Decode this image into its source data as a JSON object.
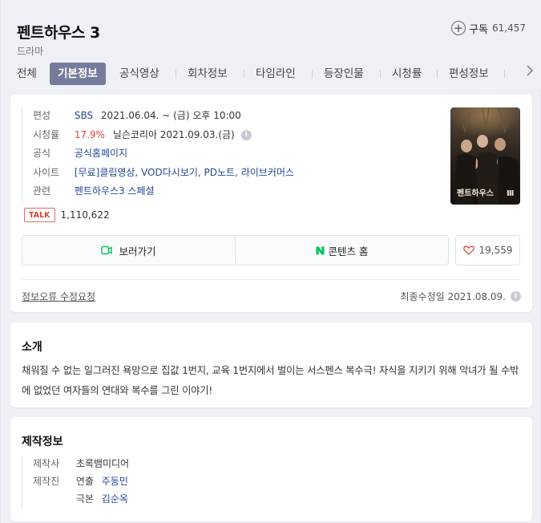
{
  "header": {
    "title": "펜트하우스 3",
    "genre": "드라마",
    "subscribe_label": "구독",
    "subscribe_count": "61,457"
  },
  "tabs": [
    {
      "label": "전체",
      "active": false
    },
    {
      "label": "기본정보",
      "active": true
    },
    {
      "label": "공식영상",
      "active": false
    },
    {
      "label": "회차정보",
      "active": false
    },
    {
      "label": "타임라인",
      "active": false
    },
    {
      "label": "등장인물",
      "active": false
    },
    {
      "label": "시청률",
      "active": false
    },
    {
      "label": "편성정보",
      "active": false
    }
  ],
  "info": {
    "broadcast": {
      "label": "편성",
      "channel": "SBS",
      "schedule": "2021.06.04. ~ (금) 오후 10:00"
    },
    "rating": {
      "label": "시청률",
      "value": "17.9%",
      "source": "닐슨코리아 2021.09.03.(금)"
    },
    "official": {
      "label": "공식",
      "link": "공식홈페이지"
    },
    "site": {
      "label": "사이트",
      "links": "[무료]클립영상, VOD다시보기, PD노트, 라이브커머스"
    },
    "related": {
      "label": "관련",
      "link": "펜트하우스3 스페셜"
    },
    "talk": {
      "badge": "TALK",
      "count": "1,110,622"
    }
  },
  "actions": {
    "watch_label": "보러가기",
    "content_home_label": "콘텐츠 홈",
    "like_count": "19,559"
  },
  "footer": {
    "report_link": "정보오류 수정요청",
    "updated": "최종수정일 2021.08.09."
  },
  "intro": {
    "title": "소개",
    "text": "채워질 수 없는 일그러진 욕망으로 집값 1번지, 교육 1번지에서 벌이는 서스펜스 복수극! 자식을 지키기 위해 악녀가 될 수밖에 없었던 여자들의 연대와 복수를 그린 이야기!"
  },
  "production": {
    "title": "제작정보",
    "company_label": "제작사",
    "company": "초록뱀미디어",
    "staff_label": "제작진",
    "director_label": "연출",
    "director": "주동민",
    "writer_label": "극본",
    "writer": "김순옥"
  },
  "colors": {
    "active_tab": "#757c9b",
    "link_blue": "#234795",
    "rating_red": "#e0443e",
    "naver_green": "#03c75a"
  }
}
